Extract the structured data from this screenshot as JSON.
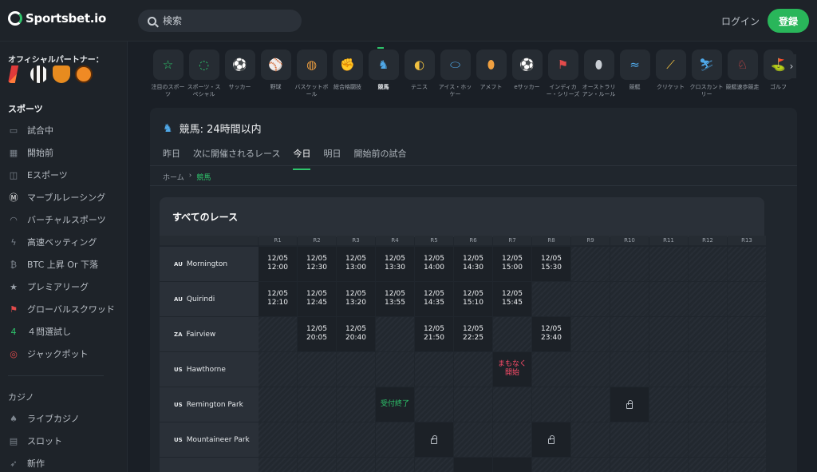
{
  "header": {
    "brand": "Sportsbet.io",
    "search_placeholder": "検索",
    "login": "ログイン",
    "register": "登録"
  },
  "sidebar": {
    "partners_title": "オフィシャルパートナー：",
    "sports_title": "スポーツ",
    "sports_items": [
      {
        "label": "試合中",
        "icon": "monitor-icon"
      },
      {
        "label": "開始前",
        "icon": "calendar-icon"
      },
      {
        "label": "Eスポーツ",
        "icon": "gamepad-icon"
      },
      {
        "label": "マーブルレーシング",
        "icon": "marble-icon"
      },
      {
        "label": "バーチャルスポーツ",
        "icon": "headset-icon"
      },
      {
        "label": "高速ベッティング",
        "icon": "bolt-icon"
      },
      {
        "label": "BTC 上昇 Or 下落",
        "icon": "bitcoin-icon"
      },
      {
        "label": "プレミアリーグ",
        "icon": "star-icon"
      },
      {
        "label": "グローバルスクワッド",
        "icon": "squad-icon"
      },
      {
        "label": "４問選試し",
        "icon": "four-icon"
      },
      {
        "label": "ジャックポット",
        "icon": "target-icon"
      }
    ],
    "casino_title": "カジノ",
    "casino_items": [
      {
        "label": "ライブカジノ",
        "icon": "dealer-icon"
      },
      {
        "label": "スロット",
        "icon": "slot-icon"
      },
      {
        "label": "新作",
        "icon": "rocket-icon"
      }
    ]
  },
  "sports": [
    {
      "label": "注目のスポーツ",
      "icon": "star-icon",
      "color": "#2ec46b",
      "glyph": "☆"
    },
    {
      "label": "スポーツ・スペシャル",
      "icon": "special-icon",
      "color": "#2ec46b",
      "glyph": "◌"
    },
    {
      "label": "サッカー",
      "icon": "soccer-icon",
      "color": "#e34b4b",
      "glyph": "⚽"
    },
    {
      "label": "野球",
      "icon": "baseball-icon",
      "color": "#c9ced4",
      "glyph": "⚾"
    },
    {
      "label": "バスケットボール",
      "icon": "basketball-icon",
      "color": "#f0a040",
      "glyph": "◍"
    },
    {
      "label": "総合格闘技",
      "icon": "mma-icon",
      "color": "#f0c040",
      "glyph": "✊"
    },
    {
      "label": "競馬",
      "icon": "horse-racing-icon",
      "color": "#4fa8e8",
      "glyph": "♞"
    },
    {
      "label": "テニス",
      "icon": "tennis-icon",
      "color": "#f0c040",
      "glyph": "◐"
    },
    {
      "label": "アイス・ホッケー",
      "icon": "hockey-icon",
      "color": "#4fa8e8",
      "glyph": "⬭"
    },
    {
      "label": "アメフト",
      "icon": "football-icon",
      "color": "#f0a040",
      "glyph": "⬮"
    },
    {
      "label": "eサッカー",
      "icon": "esoccer-icon",
      "color": "#e34b4b",
      "glyph": "⚽"
    },
    {
      "label": "インディカー・シリーズ",
      "icon": "indycar-icon",
      "color": "#e34b4b",
      "glyph": "⚑"
    },
    {
      "label": "オーストラリアン・ルール",
      "icon": "aussie-rules-icon",
      "color": "#c9ced4",
      "glyph": "⬮"
    },
    {
      "label": "競艇",
      "icon": "boat-icon",
      "color": "#4fa8e8",
      "glyph": "≈"
    },
    {
      "label": "クリケット",
      "icon": "cricket-icon",
      "color": "#f0c040",
      "glyph": "⟋"
    },
    {
      "label": "クロスカントリー",
      "icon": "ski-icon",
      "color": "#4fa8e8",
      "glyph": "⛷"
    },
    {
      "label": "競艇速歩競走",
      "icon": "harness-icon",
      "color": "#e34b4b",
      "glyph": "♘"
    },
    {
      "label": "ゴルフ",
      "icon": "golf-icon",
      "color": "#f0c040",
      "glyph": "⛳"
    }
  ],
  "panel": {
    "title": "競馬: 24時間以内",
    "tabs": [
      "昨日",
      "次に開催されるレース",
      "今日",
      "明日",
      "開始前の試合"
    ],
    "active_tab": 2,
    "breadcrumb": {
      "home": "ホーム",
      "current": "競馬"
    },
    "races_title": "すべてのレース"
  },
  "race_headers": [
    "R1",
    "R2",
    "R3",
    "R4",
    "R5",
    "R6",
    "R7",
    "R8",
    "R9",
    "R10",
    "R11",
    "R12",
    "R13"
  ],
  "races": [
    {
      "cc": "AU",
      "name": "Mornington",
      "cells": [
        {
          "t": "time",
          "v": "12/05\n12:00"
        },
        {
          "t": "time",
          "v": "12/05\n12:30"
        },
        {
          "t": "time",
          "v": "12/05\n13:00"
        },
        {
          "t": "time",
          "v": "12/05\n13:30"
        },
        {
          "t": "time",
          "v": "12/05\n14:00"
        },
        {
          "t": "time",
          "v": "12/05\n14:30"
        },
        {
          "t": "time",
          "v": "12/05\n15:00"
        },
        {
          "t": "time",
          "v": "12/05\n15:30"
        },
        {
          "t": "empty"
        },
        {
          "t": "empty"
        },
        {
          "t": "empty"
        },
        {
          "t": "empty"
        },
        {
          "t": "empty"
        }
      ]
    },
    {
      "cc": "AU",
      "name": "Quirindi",
      "cells": [
        {
          "t": "time",
          "v": "12/05\n12:10"
        },
        {
          "t": "time",
          "v": "12/05\n12:45"
        },
        {
          "t": "time",
          "v": "12/05\n13:20"
        },
        {
          "t": "time",
          "v": "12/05\n13:55"
        },
        {
          "t": "time",
          "v": "12/05\n14:35"
        },
        {
          "t": "time",
          "v": "12/05\n15:10"
        },
        {
          "t": "time",
          "v": "12/05\n15:45"
        },
        {
          "t": "empty"
        },
        {
          "t": "empty"
        },
        {
          "t": "empty"
        },
        {
          "t": "empty"
        },
        {
          "t": "empty"
        },
        {
          "t": "empty"
        }
      ]
    },
    {
      "cc": "ZA",
      "name": "Fairview",
      "cells": [
        {
          "t": "empty"
        },
        {
          "t": "time",
          "v": "12/05\n20:05"
        },
        {
          "t": "time",
          "v": "12/05\n20:40"
        },
        {
          "t": "empty"
        },
        {
          "t": "time",
          "v": "12/05\n21:50"
        },
        {
          "t": "time",
          "v": "12/05\n22:25"
        },
        {
          "t": "empty"
        },
        {
          "t": "time",
          "v": "12/05\n23:40"
        },
        {
          "t": "empty"
        },
        {
          "t": "empty"
        },
        {
          "t": "empty"
        },
        {
          "t": "empty"
        },
        {
          "t": "empty"
        }
      ]
    },
    {
      "cc": "US",
      "name": "Hawthorne",
      "cells": [
        {
          "t": "empty"
        },
        {
          "t": "empty"
        },
        {
          "t": "empty"
        },
        {
          "t": "empty"
        },
        {
          "t": "empty"
        },
        {
          "t": "empty"
        },
        {
          "t": "soon",
          "v": "まもなく\n開始"
        },
        {
          "t": "empty"
        },
        {
          "t": "empty"
        },
        {
          "t": "empty"
        },
        {
          "t": "empty"
        },
        {
          "t": "empty"
        },
        {
          "t": "empty"
        }
      ]
    },
    {
      "cc": "US",
      "name": "Remington Park",
      "cells": [
        {
          "t": "empty"
        },
        {
          "t": "empty"
        },
        {
          "t": "empty"
        },
        {
          "t": "closed",
          "v": "受付終了"
        },
        {
          "t": "empty"
        },
        {
          "t": "empty"
        },
        {
          "t": "empty"
        },
        {
          "t": "empty"
        },
        {
          "t": "empty"
        },
        {
          "t": "lock"
        },
        {
          "t": "empty"
        },
        {
          "t": "empty"
        },
        {
          "t": "empty"
        }
      ]
    },
    {
      "cc": "US",
      "name": "Mountaineer Park",
      "cells": [
        {
          "t": "empty"
        },
        {
          "t": "empty"
        },
        {
          "t": "empty"
        },
        {
          "t": "empty"
        },
        {
          "t": "lock"
        },
        {
          "t": "empty"
        },
        {
          "t": "empty"
        },
        {
          "t": "lock"
        },
        {
          "t": "empty"
        },
        {
          "t": "empty"
        },
        {
          "t": "empty"
        },
        {
          "t": "empty"
        },
        {
          "t": "empty"
        }
      ]
    },
    {
      "cc": "US",
      "name": "",
      "cells": [
        {
          "t": "empty"
        },
        {
          "t": "empty"
        },
        {
          "t": "empty"
        },
        {
          "t": "empty"
        },
        {
          "t": "empty"
        },
        {
          "t": "closed",
          "v": ""
        },
        {
          "t": "time",
          "v": ""
        },
        {
          "t": "empty"
        },
        {
          "t": "empty"
        },
        {
          "t": "empty"
        },
        {
          "t": "empty"
        },
        {
          "t": "empty"
        },
        {
          "t": "empty"
        }
      ]
    }
  ]
}
